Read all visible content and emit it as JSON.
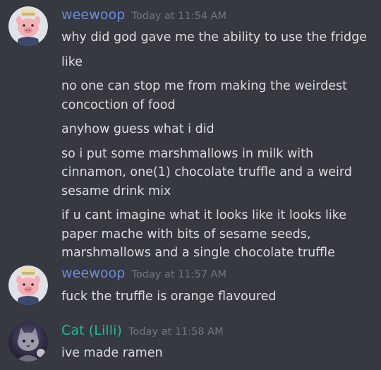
{
  "messages": [
    {
      "author": "weewoop",
      "author_color": "#7289da",
      "timestamp": "Today at 11:54 AM",
      "avatar_icon": "pig-avatar-icon",
      "lines": [
        "why did god gave me the ability to use the fridge",
        "like",
        "no one can stop me from making the weirdest concoction of food",
        "anyhow guess what i did",
        "so i put some marshmallows in milk with cinnamon, one(1) chocolate truffle and a weird sesame drink mix",
        "if u cant imagine what it looks like it looks like paper mache with bits of sesame seeds, marshmallows and a single chocolate truffle"
      ]
    },
    {
      "author": "weewoop",
      "author_color": "#7289da",
      "timestamp": "Today at 11:57 AM",
      "avatar_icon": "pig-avatar-icon",
      "lines": [
        "fuck the truffle is orange flavoured"
      ]
    },
    {
      "author": "Cat (Lilli)",
      "author_color": "#1abc9c",
      "timestamp": "Today at 11:58 AM",
      "avatar_icon": "cat-avatar-icon",
      "lines": [
        "ive made ramen"
      ]
    }
  ]
}
